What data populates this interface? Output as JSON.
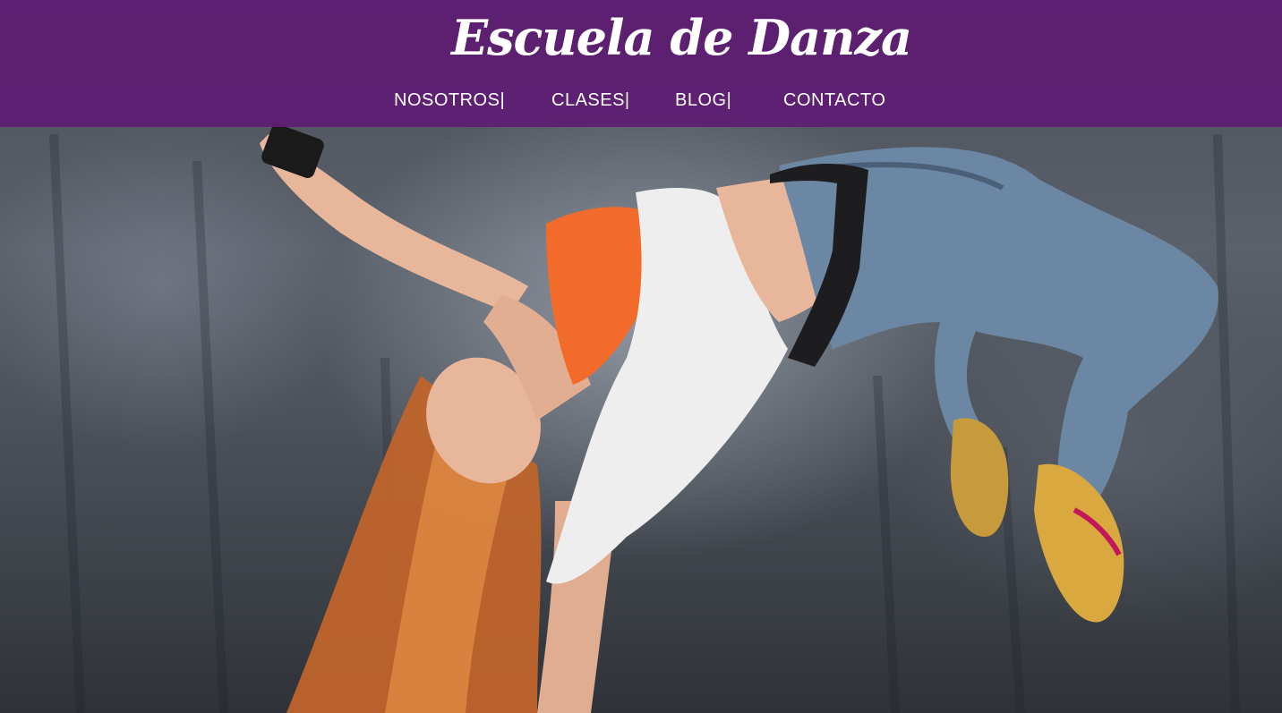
{
  "site": {
    "title": "Escuela de Danza"
  },
  "nav": {
    "items": [
      {
        "label": "NOSOTROS|"
      },
      {
        "label": "CLASES|"
      },
      {
        "label": "BLOG|"
      },
      {
        "label": "CONTACTO"
      }
    ]
  },
  "colors": {
    "header_bg": "#5f1c73",
    "text": "#ffffff"
  },
  "hero": {
    "image": "dancer-hero-photo"
  }
}
